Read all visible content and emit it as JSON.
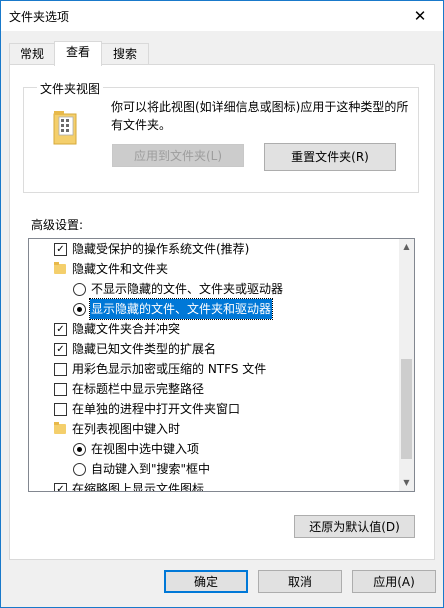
{
  "window": {
    "title": "文件夹选项",
    "close_glyph": "✕"
  },
  "tabs": [
    {
      "label": "常规"
    },
    {
      "label": "查看"
    },
    {
      "label": "搜索"
    }
  ],
  "folder_views": {
    "group_label": "文件夹视图",
    "description": "你可以将此视图(如详细信息或图标)应用于这种类型的所有文件夹。",
    "apply_button": "应用到文件夹(L)",
    "reset_button": "重置文件夹(R)"
  },
  "advanced": {
    "label": "高级设置:",
    "items": [
      {
        "type": "checkbox",
        "checked": true,
        "label": "隐藏受保护的操作系统文件(推荐)"
      },
      {
        "type": "folder",
        "label": "隐藏文件和文件夹"
      },
      {
        "type": "radio",
        "checked": false,
        "label": "不显示隐藏的文件、文件夹或驱动器"
      },
      {
        "type": "radio",
        "checked": true,
        "selected": true,
        "label": "显示隐藏的文件、文件夹和驱动器"
      },
      {
        "type": "checkbox",
        "checked": true,
        "label": "隐藏文件夹合并冲突"
      },
      {
        "type": "checkbox",
        "checked": true,
        "label": "隐藏已知文件类型的扩展名"
      },
      {
        "type": "checkbox",
        "checked": false,
        "label": "用彩色显示加密或压缩的 NTFS 文件"
      },
      {
        "type": "checkbox",
        "checked": false,
        "label": "在标题栏中显示完整路径"
      },
      {
        "type": "checkbox",
        "checked": false,
        "label": "在单独的进程中打开文件夹窗口"
      },
      {
        "type": "folder",
        "label": "在列表视图中键入时"
      },
      {
        "type": "radio",
        "checked": true,
        "label": "在视图中选中键入项"
      },
      {
        "type": "radio",
        "checked": false,
        "label": "自动键入到\"搜索\"框中"
      },
      {
        "type": "checkbox",
        "checked": true,
        "label": "在缩略图上显示文件图标"
      }
    ]
  },
  "restore_button": "还原为默认值(D)",
  "footer": {
    "ok": "确定",
    "cancel": "取消",
    "apply": "应用(A)"
  },
  "icons": {
    "checkmark": "✓",
    "scroll_up": "▲",
    "scroll_down": "▼"
  }
}
